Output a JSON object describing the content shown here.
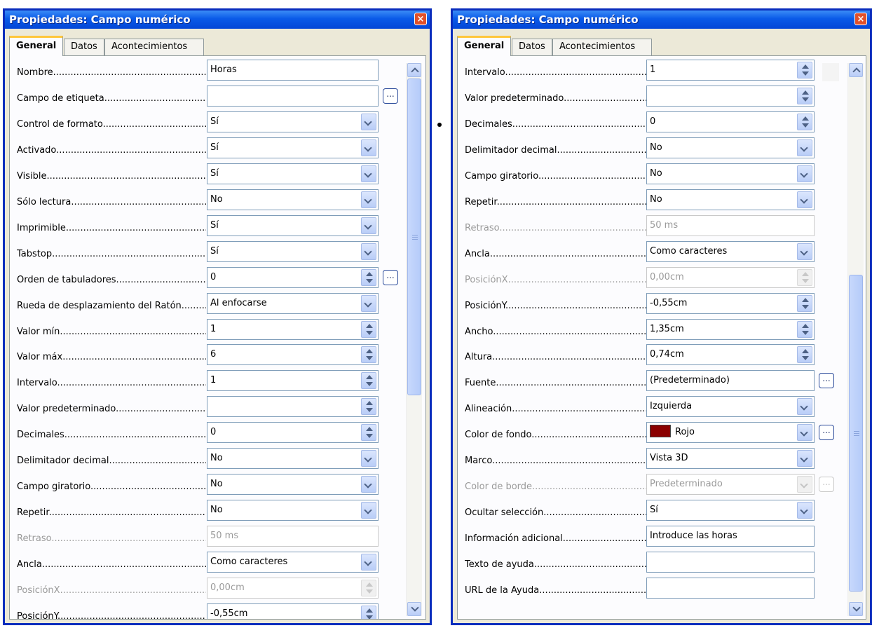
{
  "left_window": {
    "title": "Propiedades: Campo numérico",
    "close_label": "×",
    "tabs": [
      "General",
      "Datos",
      "Acontecimientos"
    ],
    "rows": [
      {
        "label": "Nombre",
        "value": "Horas",
        "type": "text"
      },
      {
        "label": "Campo de etiqueta",
        "value": "",
        "type": "text",
        "ellipsis": true
      },
      {
        "label": "Control de formato",
        "value": "Sí",
        "type": "dropdown"
      },
      {
        "label": "Activado",
        "value": "Sí",
        "type": "dropdown"
      },
      {
        "label": "Visible",
        "value": "Sí",
        "type": "dropdown"
      },
      {
        "label": "Sólo lectura",
        "value": "No",
        "type": "dropdown"
      },
      {
        "label": "Imprimible",
        "value": "Sí",
        "type": "dropdown"
      },
      {
        "label": "Tabstop",
        "value": "Sí",
        "type": "dropdown"
      },
      {
        "label": "Orden de tabuladores",
        "value": "0",
        "type": "spin",
        "ellipsis": true
      },
      {
        "label": "Rueda de desplazamiento del Ratón",
        "value": "Al enfocarse",
        "type": "dropdown"
      },
      {
        "label": "Valor mín",
        "value": "1",
        "type": "spin"
      },
      {
        "label": "Valor máx",
        "value": "6",
        "type": "spin"
      },
      {
        "label": "Intervalo",
        "value": "1",
        "type": "spin"
      },
      {
        "label": "Valor predeterminado",
        "value": "",
        "type": "spin"
      },
      {
        "label": "Decimales",
        "value": "0",
        "type": "spin"
      },
      {
        "label": "Delimitador decimal",
        "value": "No",
        "type": "dropdown"
      },
      {
        "label": "Campo giratorio",
        "value": "No",
        "type": "dropdown"
      },
      {
        "label": "Repetir",
        "value": "No",
        "type": "dropdown"
      },
      {
        "label": "Retraso",
        "value": "50 ms",
        "type": "text",
        "disabled": true
      },
      {
        "label": "Ancla",
        "value": "Como caracteres",
        "type": "dropdown"
      },
      {
        "label": "PosiciónX",
        "value": "0,00cm",
        "type": "spin",
        "disabled": true
      },
      {
        "label": "PosiciónY",
        "value": "-0,55cm",
        "type": "spin"
      }
    ]
  },
  "right_window": {
    "title": "Propiedades: Campo numérico",
    "close_label": "×",
    "tabs": [
      "General",
      "Datos",
      "Acontecimientos"
    ],
    "rows": [
      {
        "label": "Intervalo",
        "value": "1",
        "type": "spin"
      },
      {
        "label": "Valor predeterminado",
        "value": "",
        "type": "spin"
      },
      {
        "label": "Decimales",
        "value": "0",
        "type": "spin"
      },
      {
        "label": "Delimitador decimal",
        "value": "No",
        "type": "dropdown"
      },
      {
        "label": "Campo giratorio",
        "value": "No",
        "type": "dropdown"
      },
      {
        "label": "Repetir",
        "value": "No",
        "type": "dropdown"
      },
      {
        "label": "Retraso",
        "value": "50 ms",
        "type": "text",
        "disabled": true
      },
      {
        "label": "Ancla",
        "value": "Como caracteres",
        "type": "dropdown"
      },
      {
        "label": "PosiciónX",
        "value": "0,00cm",
        "type": "spin",
        "disabled": true
      },
      {
        "label": "PosiciónY",
        "value": "-0,55cm",
        "type": "spin"
      },
      {
        "label": "Ancho",
        "value": "1,35cm",
        "type": "spin"
      },
      {
        "label": "Altura",
        "value": "0,74cm",
        "type": "spin"
      },
      {
        "label": "Fuente",
        "value": "(Predeterminado)",
        "type": "text",
        "ellipsis": true
      },
      {
        "label": "Alineación",
        "value": "Izquierda",
        "type": "dropdown"
      },
      {
        "label": "Color de fondo",
        "value": "Rojo",
        "type": "dropdown",
        "swatch": "#8b0000",
        "ellipsis": true
      },
      {
        "label": "Marco",
        "value": "Vista 3D",
        "type": "dropdown"
      },
      {
        "label": "Color de borde",
        "value": "Predeterminado",
        "type": "dropdown",
        "disabled": true,
        "ellipsis": true,
        "ellipsis_disabled": true
      },
      {
        "label": "Ocultar selección",
        "value": "Sí",
        "type": "dropdown"
      },
      {
        "label": "Información adicional",
        "value": "Introduce las horas",
        "type": "text"
      },
      {
        "label": "Texto de ayuda",
        "value": "",
        "type": "text"
      },
      {
        "label": "URL de la Ayuda",
        "value": "",
        "type": "text"
      }
    ]
  },
  "colors": {
    "titlebar": "#0a5ae8",
    "accent_tab": "#ffc73c",
    "background_swatch_rojo": "#8b0000"
  }
}
